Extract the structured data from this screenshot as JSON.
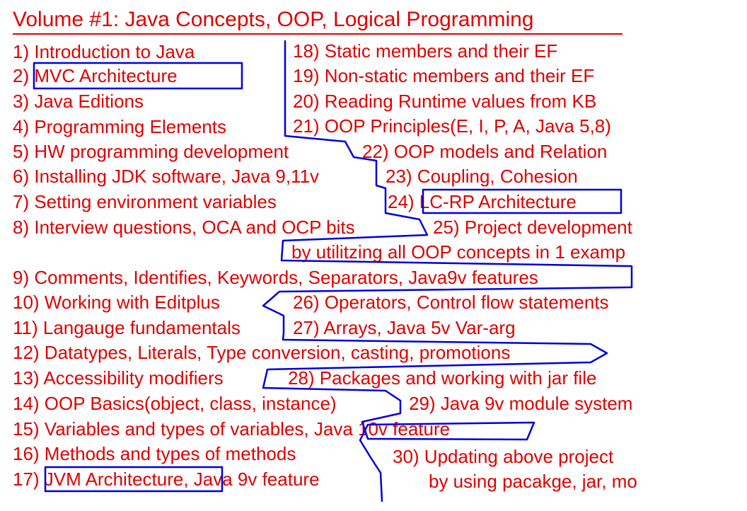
{
  "title": "Volume #1: Java Concepts, OOP, Logical Programming",
  "colors": {
    "text": "#e00000",
    "marker": "#0000dd",
    "background": "#ffffff"
  },
  "left_column": [
    "1) Introduction to Java",
    "2) MVC Architecture",
    "3) Java Editions",
    "4) Programming Elements",
    "5) HW programming development",
    "6) Installing JDK software, Java 9,11v",
    "7) Setting environment variables",
    "8) Interview questions, OCA and OCP bits",
    "9) Comments, Identifies, Keywords, Separators, Java9v features",
    "10) Working with Editplus",
    "11) Langauge fundamentals",
    "12) Datatypes, Literals, Type conversion, casting, promotions",
    "13) Accessibility modifiers",
    "14) OOP Basics(object, class, instance)",
    "15) Variables and types of variables, Java 10v feature",
    "16) Methods and types of methods",
    "17) JVM Architecture, Java 9v feature"
  ],
  "right_column": [
    "18) Static members and their EF",
    "19) Non-static members and their EF",
    "20) Reading Runtime values from KB",
    "21) OOP Principles(E, I, P, A, Java 5,8)",
    "22) OOP models and Relation",
    "23) Coupling, Cohesion",
    "24) LC-RP Architecture",
    "25) Project development",
    "by utilitzing all OOP concepts in 1 examp",
    "26) Operators, Control flow statements",
    "27) Arrays, Java 5v Var-arg",
    "28) Packages and working with jar file",
    "29) Java 9v module system",
    "30) Updating above project",
    "by using pacakge, jar, mo"
  ]
}
